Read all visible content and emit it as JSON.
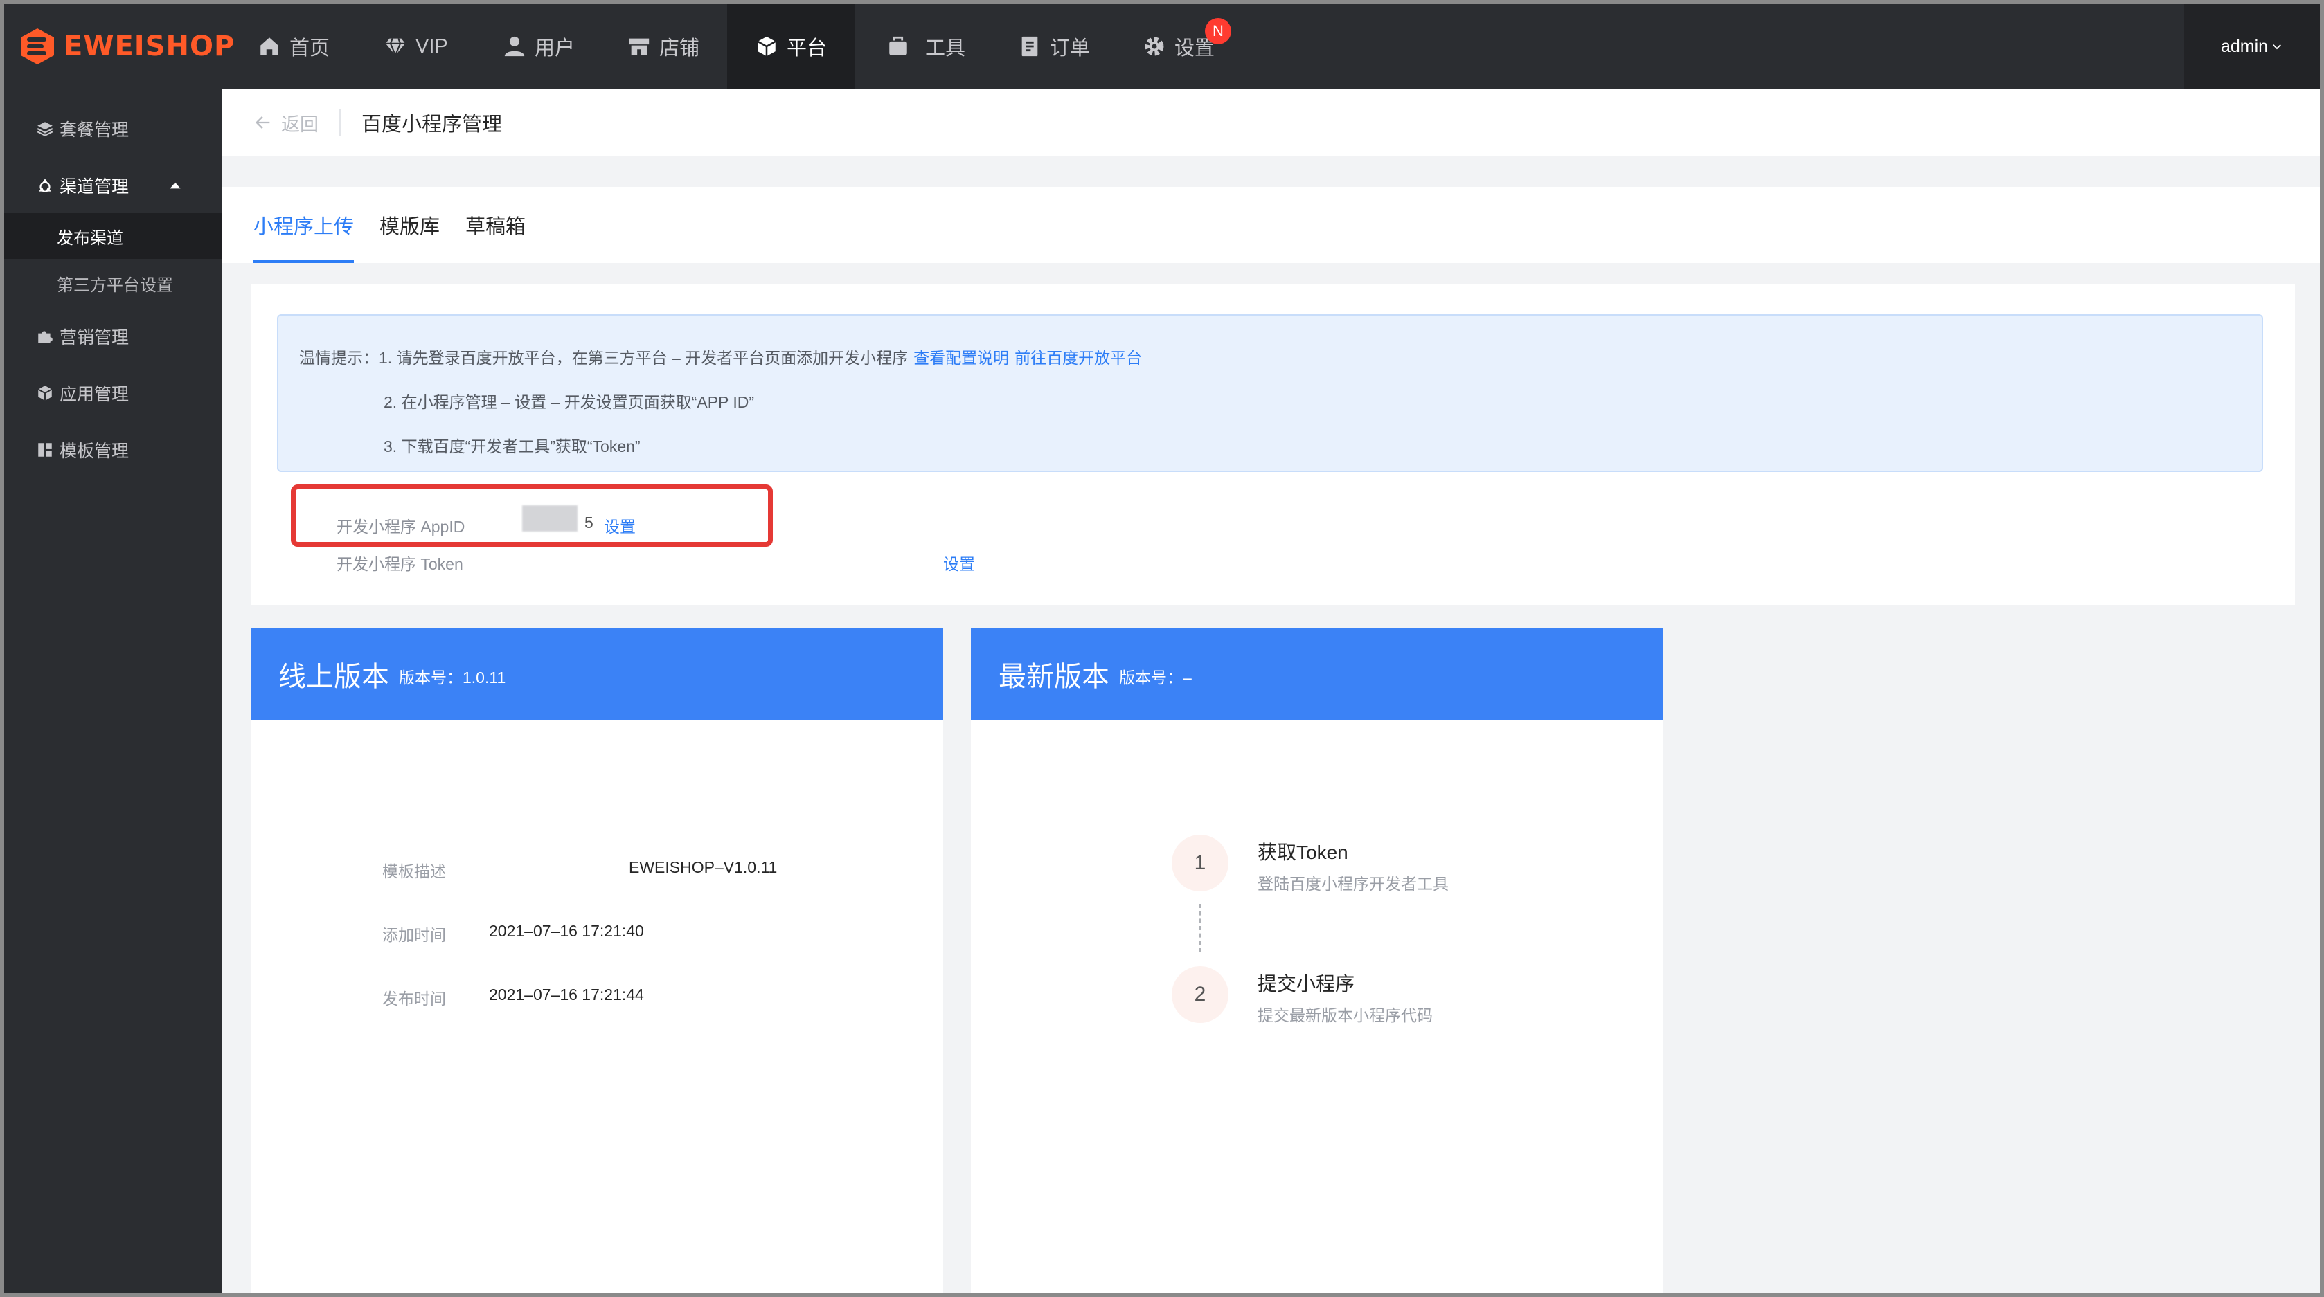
{
  "brand": {
    "name": "EWEISHOP"
  },
  "topnav": {
    "items": [
      {
        "label": "首页",
        "icon": "home-icon"
      },
      {
        "label": "VIP",
        "icon": "diamond-icon"
      },
      {
        "label": "用户",
        "icon": "user-icon"
      },
      {
        "label": "店铺",
        "icon": "store-icon"
      },
      {
        "label": "平台",
        "icon": "box-icon",
        "active": true
      },
      {
        "label": "工具",
        "icon": "toolbox-icon"
      },
      {
        "label": "订单",
        "icon": "order-icon"
      },
      {
        "label": "设置",
        "icon": "gear-icon",
        "badge": "N"
      }
    ],
    "user": "admin"
  },
  "sidebar": {
    "items": [
      {
        "label": "套餐管理",
        "icon": "layers-icon"
      },
      {
        "label": "渠道管理",
        "icon": "recycle-icon",
        "expanded": true,
        "children": [
          {
            "label": "发布渠道",
            "active": true
          },
          {
            "label": "第三方平台设置"
          }
        ]
      },
      {
        "label": "营销管理",
        "icon": "puzzle-icon"
      },
      {
        "label": "应用管理",
        "icon": "cube-icon"
      },
      {
        "label": "模板管理",
        "icon": "template-icon"
      }
    ]
  },
  "header": {
    "back_label": "返回",
    "title": "百度小程序管理"
  },
  "tabs": [
    {
      "label": "小程序上传",
      "active": true
    },
    {
      "label": "模版库"
    },
    {
      "label": "草稿箱"
    }
  ],
  "tips": {
    "prefix": "温情提示：",
    "line1": "1. 请先登录百度开放平台，在第三方平台 – 开发者平台页面添加开发小程序",
    "link1": "查看配置说明",
    "link2": "前往百度开放平台",
    "line2": "2. 在小程序管理 – 设置 – 开发设置页面获取“APP ID”",
    "line3": "3. 下载百度“开发者工具”获取“Token”"
  },
  "settings": {
    "appid_label": "开发小程序 AppID",
    "appid_value_tail": "5",
    "appid_action": "设置",
    "token_label": "开发小程序 Token",
    "token_action": "设置"
  },
  "online_version": {
    "title": "线上版本",
    "version_label": "版本号：1.0.11",
    "rows": [
      {
        "label": "模板描述",
        "value": "EWEISHOP–V1.0.11"
      },
      {
        "label": "添加时间",
        "value": "2021–07–16 17:21:40"
      },
      {
        "label": "发布时间",
        "value": "2021–07–16 17:21:44"
      }
    ]
  },
  "latest_version": {
    "title": "最新版本",
    "version_label": "版本号：–",
    "steps": [
      {
        "num": "1",
        "title": "获取Token",
        "desc": "登陆百度小程序开发者工具"
      },
      {
        "num": "2",
        "title": "提交小程序",
        "desc": "提交最新版本小程序代码"
      }
    ]
  },
  "colors": {
    "accent": "#2d7df6",
    "brand": "#ff5a28",
    "version_header": "#3b82f6",
    "highlight_box": "#e53935"
  }
}
